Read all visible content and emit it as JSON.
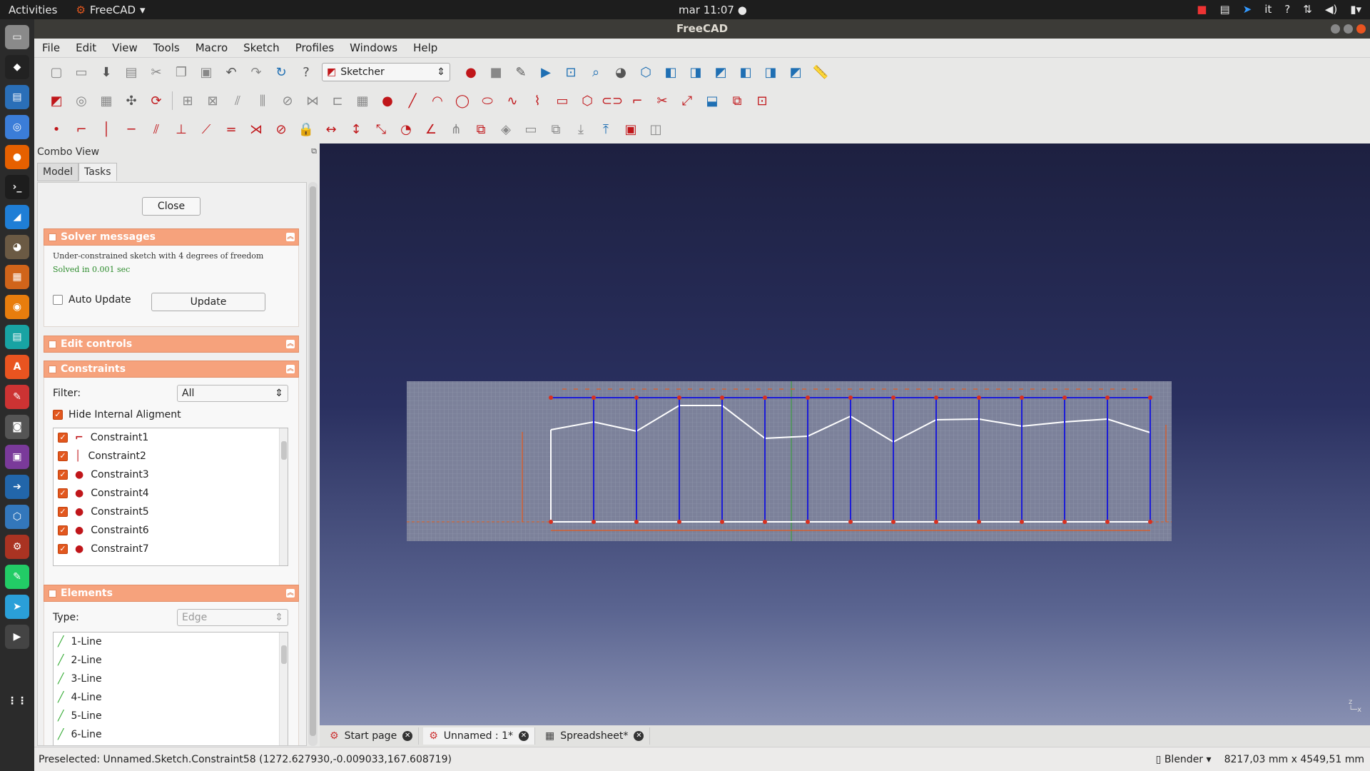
{
  "topbar": {
    "activities": "Activities",
    "app": "FreeCAD",
    "clock": "mar 11:07",
    "lang": "it",
    "help": "?"
  },
  "window": {
    "title": "FreeCAD"
  },
  "menu": [
    "File",
    "Edit",
    "View",
    "Tools",
    "Macro",
    "Sketch",
    "Profiles",
    "Windows",
    "Help"
  ],
  "toolbar": {
    "workbench": "Sketcher"
  },
  "combo": {
    "title": "Combo View",
    "tabs": [
      "Model",
      "Tasks"
    ]
  },
  "tasks": {
    "close": "Close",
    "solver": {
      "title": "Solver messages",
      "msg": "Under-constrained sketch with 4 degrees of freedom",
      "solved": "Solved in 0.001 sec",
      "auto_update": "Auto Update",
      "update": "Update"
    },
    "edit_controls": "Edit controls",
    "constraints": {
      "title": "Constraints",
      "filter_label": "Filter:",
      "filter_value": "All",
      "hide_internal": "Hide Internal Aligment",
      "items": [
        "Constraint1",
        "Constraint2",
        "Constraint3",
        "Constraint4",
        "Constraint5",
        "Constraint6",
        "Constraint7"
      ]
    },
    "elements": {
      "title": "Elements",
      "type_label": "Type:",
      "type_value": "Edge",
      "items": [
        "1-Line",
        "2-Line",
        "3-Line",
        "4-Line",
        "5-Line",
        "6-Line"
      ]
    }
  },
  "doc_tabs": [
    "Start page",
    "Unnamed : 1*",
    "Spreadsheet*"
  ],
  "status": {
    "text": "Preselected: Unnamed.Sketch.Constraint58 (1272.627930,-0.009033,167.608719)",
    "nav": "Blender",
    "dims": "8217,03 mm x 4549,51 mm"
  },
  "colors": {
    "accent": "#f6a27c",
    "constraint": "#c0161a",
    "line_blue": "#1c1cd8"
  }
}
